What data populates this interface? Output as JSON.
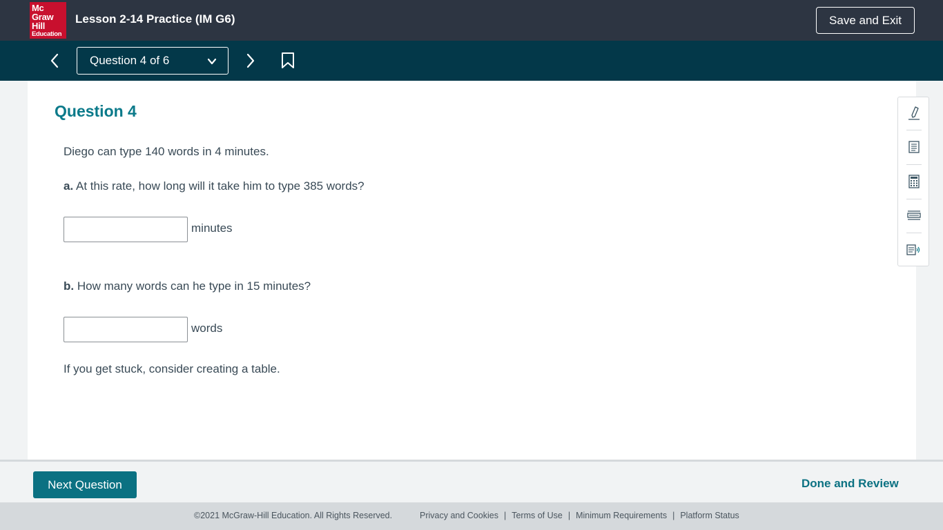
{
  "header": {
    "logo_lines": [
      "Mc",
      "Graw",
      "Hill",
      "Education"
    ],
    "title": "Lesson 2-14 Practice (IM G6)",
    "save_exit_label": "Save and Exit"
  },
  "nav": {
    "question_select": "Question 4 of 6",
    "prev_icon": "chevron-left-icon",
    "next_icon": "chevron-right-icon",
    "bookmark_icon": "bookmark-icon"
  },
  "question": {
    "heading": "Question 4",
    "prompt": "Diego can type 140 words in 4 minutes.",
    "part_a_label": "a.",
    "part_a_text": "At this rate, how long will it take him to type 385 words?",
    "part_a_value": "",
    "part_a_unit": "minutes",
    "part_b_label": "b.",
    "part_b_text": "How many words can he type in 15 minutes?",
    "part_b_value": "",
    "part_b_unit": "words",
    "hint": "If you get stuck, consider creating a table."
  },
  "tools": [
    "highlighter-icon",
    "notes-icon",
    "calculator-icon",
    "line-reader-icon",
    "text-to-speech-icon"
  ],
  "actions": {
    "next_question": "Next Question",
    "done_review": "Done and Review"
  },
  "footer": {
    "copyright": "©2021 McGraw-Hill Education. All Rights Reserved.",
    "links": [
      "Privacy and Cookies",
      "Terms of Use",
      "Minimum Requirements",
      "Platform Status"
    ]
  },
  "colors": {
    "header_bg": "#2d3542",
    "nav_bg": "#033849",
    "accent": "#0b7182",
    "logo_red": "#c8102e"
  }
}
